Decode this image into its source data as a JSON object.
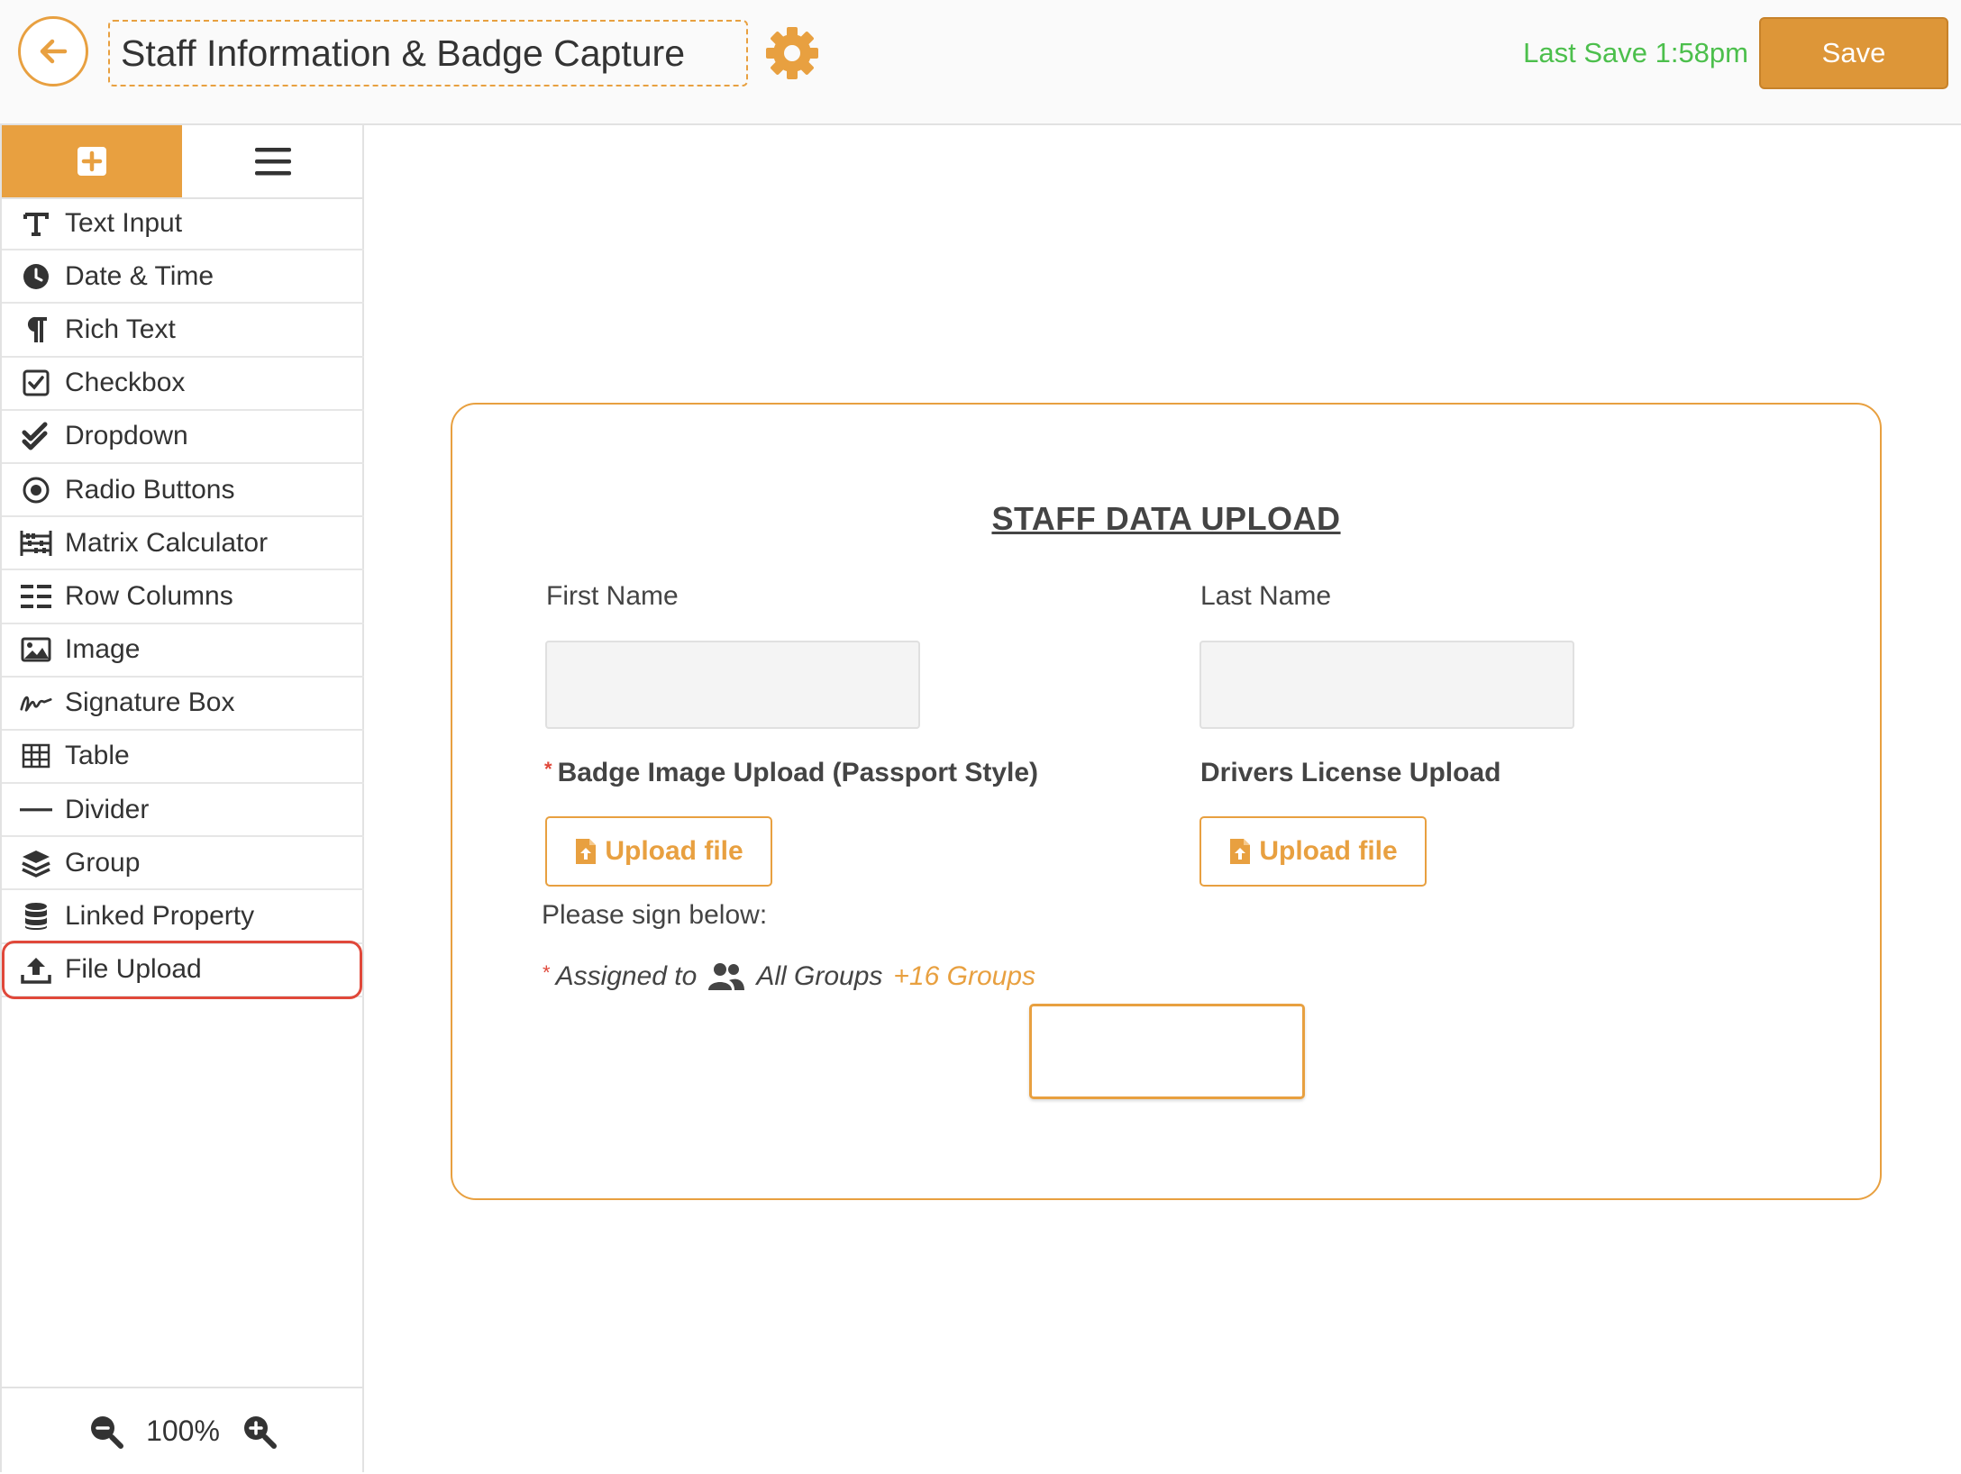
{
  "header": {
    "title": "Staff Information & Badge Capture",
    "last_save": "Last Save 1:58pm",
    "save_label": "Save"
  },
  "colors": {
    "accent": "#e8a040",
    "save_button": "#dd9638",
    "last_save_text": "#4cbf4c",
    "highlight_ring": "#e0483a"
  },
  "sidebar": {
    "tabs": [
      {
        "icon": "plus-square-icon",
        "active": true
      },
      {
        "icon": "hamburger-list-icon",
        "active": false
      }
    ],
    "items": [
      {
        "label": "Text Input",
        "icon": "text-t-icon"
      },
      {
        "label": "Date & Time",
        "icon": "clock-icon"
      },
      {
        "label": "Rich Text",
        "icon": "paragraph-icon"
      },
      {
        "label": "Checkbox",
        "icon": "checkbox-icon"
      },
      {
        "label": "Dropdown",
        "icon": "double-check-icon"
      },
      {
        "label": "Radio Buttons",
        "icon": "radio-icon"
      },
      {
        "label": "Matrix Calculator",
        "icon": "abacus-icon"
      },
      {
        "label": "Row Columns",
        "icon": "columns-icon"
      },
      {
        "label": "Image",
        "icon": "image-icon"
      },
      {
        "label": "Signature Box",
        "icon": "signature-icon"
      },
      {
        "label": "Table",
        "icon": "table-icon"
      },
      {
        "label": "Divider",
        "icon": "divider-icon"
      },
      {
        "label": "Group",
        "icon": "layers-icon"
      },
      {
        "label": "Linked Property",
        "icon": "database-icon"
      },
      {
        "label": "File Upload",
        "icon": "upload-icon",
        "highlighted": true
      }
    ],
    "zoom": "100%"
  },
  "form": {
    "title": "STAFF DATA UPLOAD",
    "first_name_label": "First Name",
    "last_name_label": "Last Name",
    "badge_upload_label": "Badge Image Upload (Passport Style)",
    "badge_required": "*",
    "license_upload_label": "Drivers License Upload",
    "upload_btn_label": "Upload file",
    "sign_prompt": "Please sign below:",
    "assigned_required": "*",
    "assigned_label": "Assigned to",
    "assigned_groups": "All Groups",
    "assigned_more": "+16 Groups"
  }
}
